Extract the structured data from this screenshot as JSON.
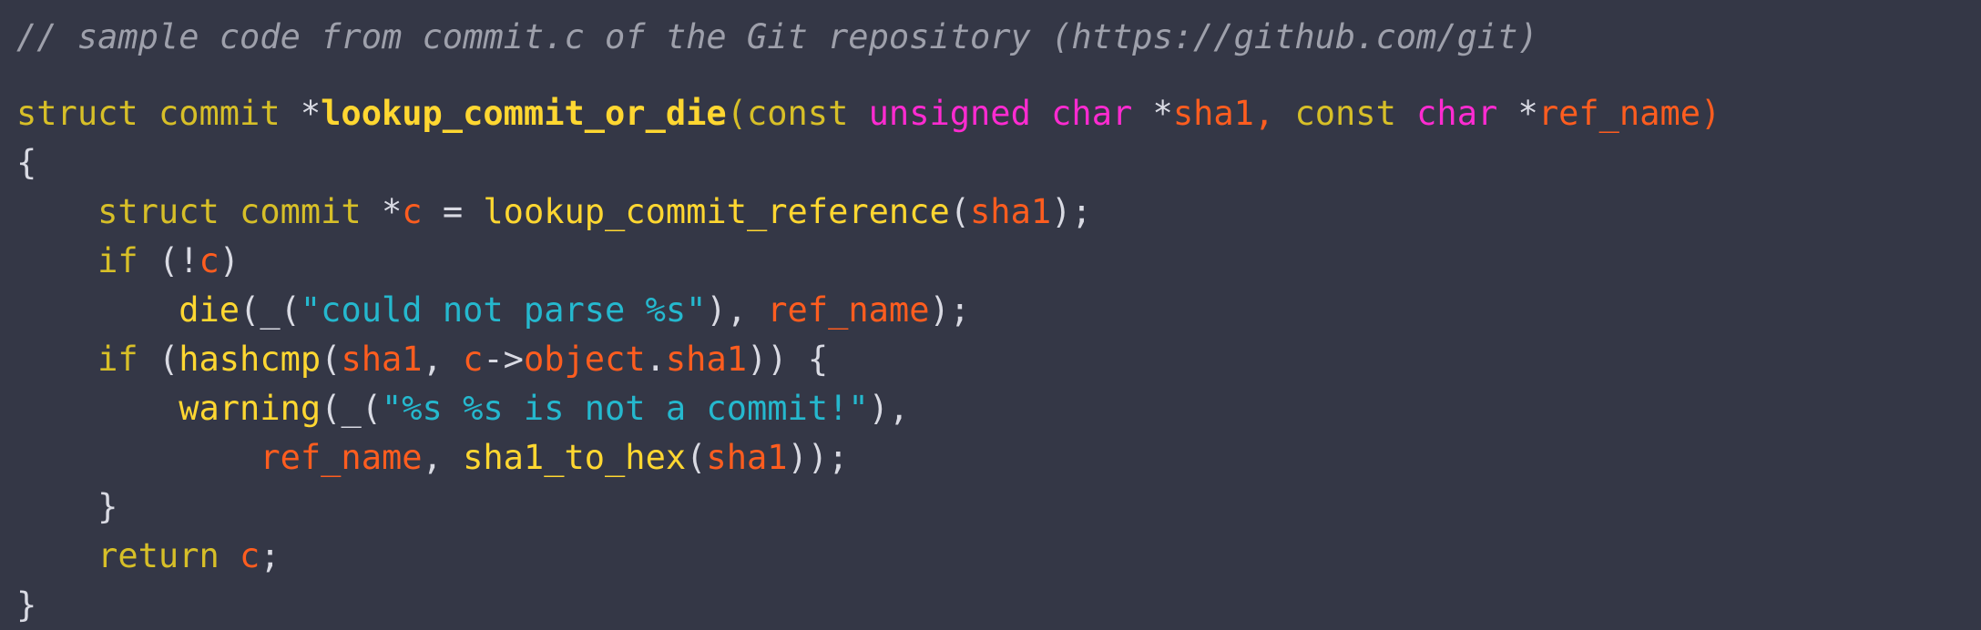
{
  "editor": {
    "background_color": "#343746",
    "font_size_px": 37,
    "language": "c"
  },
  "theme_colors": {
    "comment": "#9ea0ab",
    "keyword": "#d7bf28",
    "type": "#ff2bd1",
    "function": "#ffd731",
    "variable": "#ff5d1f",
    "string": "#25b8ce",
    "punctuation": "#d9dae3"
  },
  "comment_text": "// sample code from commit.c of the Git repository (https://github.com/git)",
  "source_file": "commit.c",
  "repository_url": "https://github.com/git",
  "code_lines": [
    {
      "id": "line-comment",
      "tokens": [
        {
          "t": "// sample code from commit.c of the Git repository (https://github.com/git)",
          "c": "tok-comment"
        }
      ]
    },
    {
      "id": "line-blank",
      "blank": true,
      "tokens": []
    },
    {
      "id": "line-signature",
      "tokens": [
        {
          "t": "struct",
          "c": "tok-keyword"
        },
        {
          "t": " ",
          "c": "tok-plain"
        },
        {
          "t": "commit",
          "c": "tok-keyword"
        },
        {
          "t": " ",
          "c": "tok-plain"
        },
        {
          "t": "*",
          "c": "tok-punct"
        },
        {
          "t": "lookup_commit_or_die",
          "c": "tok-func-def"
        },
        {
          "t": "(",
          "c": "tok-keyword"
        },
        {
          "t": "const",
          "c": "tok-keyword"
        },
        {
          "t": " ",
          "c": "tok-plain"
        },
        {
          "t": "unsigned",
          "c": "tok-type"
        },
        {
          "t": " ",
          "c": "tok-plain"
        },
        {
          "t": "char",
          "c": "tok-type"
        },
        {
          "t": " ",
          "c": "tok-plain"
        },
        {
          "t": "*",
          "c": "tok-punct"
        },
        {
          "t": "sha1",
          "c": "tok-var"
        },
        {
          "t": ",",
          "c": "tok-var"
        },
        {
          "t": " ",
          "c": "tok-plain"
        },
        {
          "t": "const",
          "c": "tok-keyword"
        },
        {
          "t": " ",
          "c": "tok-plain"
        },
        {
          "t": "char",
          "c": "tok-type"
        },
        {
          "t": " ",
          "c": "tok-plain"
        },
        {
          "t": "*",
          "c": "tok-punct"
        },
        {
          "t": "ref_name",
          "c": "tok-var"
        },
        {
          "t": ")",
          "c": "tok-var"
        }
      ]
    },
    {
      "id": "line-open-brace",
      "tokens": [
        {
          "t": "{",
          "c": "tok-punct"
        }
      ]
    },
    {
      "id": "line-decl-c",
      "tokens": [
        {
          "t": "    ",
          "c": "tok-plain"
        },
        {
          "t": "struct",
          "c": "tok-keyword"
        },
        {
          "t": " ",
          "c": "tok-plain"
        },
        {
          "t": "commit",
          "c": "tok-keyword"
        },
        {
          "t": " ",
          "c": "tok-plain"
        },
        {
          "t": "*",
          "c": "tok-punct"
        },
        {
          "t": "c",
          "c": "tok-var"
        },
        {
          "t": " ",
          "c": "tok-plain"
        },
        {
          "t": "=",
          "c": "tok-punct"
        },
        {
          "t": " ",
          "c": "tok-plain"
        },
        {
          "t": "lookup_commit_reference",
          "c": "tok-func"
        },
        {
          "t": "(",
          "c": "tok-punct"
        },
        {
          "t": "sha1",
          "c": "tok-var"
        },
        {
          "t": ");",
          "c": "tok-punct"
        }
      ]
    },
    {
      "id": "line-if-not-c",
      "tokens": [
        {
          "t": "    ",
          "c": "tok-plain"
        },
        {
          "t": "if",
          "c": "tok-keyword"
        },
        {
          "t": " ",
          "c": "tok-plain"
        },
        {
          "t": "(!",
          "c": "tok-punct"
        },
        {
          "t": "c",
          "c": "tok-var"
        },
        {
          "t": ")",
          "c": "tok-punct"
        }
      ]
    },
    {
      "id": "line-die",
      "tokens": [
        {
          "t": "        ",
          "c": "tok-plain"
        },
        {
          "t": "die",
          "c": "tok-func"
        },
        {
          "t": "(",
          "c": "tok-punct"
        },
        {
          "t": "_",
          "c": "tok-punct"
        },
        {
          "t": "(",
          "c": "tok-punct"
        },
        {
          "t": "\"could not parse %s\"",
          "c": "tok-string"
        },
        {
          "t": "),",
          "c": "tok-punct"
        },
        {
          "t": " ",
          "c": "tok-plain"
        },
        {
          "t": "ref_name",
          "c": "tok-var"
        },
        {
          "t": ");",
          "c": "tok-punct"
        }
      ]
    },
    {
      "id": "line-if-hashcmp",
      "tokens": [
        {
          "t": "    ",
          "c": "tok-plain"
        },
        {
          "t": "if",
          "c": "tok-keyword"
        },
        {
          "t": " ",
          "c": "tok-plain"
        },
        {
          "t": "(",
          "c": "tok-punct"
        },
        {
          "t": "hashcmp",
          "c": "tok-func"
        },
        {
          "t": "(",
          "c": "tok-punct"
        },
        {
          "t": "sha1",
          "c": "tok-var"
        },
        {
          "t": ",",
          "c": "tok-punct"
        },
        {
          "t": " ",
          "c": "tok-plain"
        },
        {
          "t": "c",
          "c": "tok-var"
        },
        {
          "t": "->",
          "c": "tok-punct"
        },
        {
          "t": "object",
          "c": "tok-var"
        },
        {
          "t": ".",
          "c": "tok-punct"
        },
        {
          "t": "sha1",
          "c": "tok-var"
        },
        {
          "t": ")) {",
          "c": "tok-punct"
        }
      ]
    },
    {
      "id": "line-warning",
      "tokens": [
        {
          "t": "        ",
          "c": "tok-plain"
        },
        {
          "t": "warning",
          "c": "tok-func"
        },
        {
          "t": "(",
          "c": "tok-punct"
        },
        {
          "t": "_",
          "c": "tok-punct"
        },
        {
          "t": "(",
          "c": "tok-punct"
        },
        {
          "t": "\"%s %s is not a commit!\"",
          "c": "tok-string"
        },
        {
          "t": "),",
          "c": "tok-punct"
        }
      ]
    },
    {
      "id": "line-warning-args",
      "tokens": [
        {
          "t": "            ",
          "c": "tok-plain"
        },
        {
          "t": "ref_name",
          "c": "tok-var"
        },
        {
          "t": ",",
          "c": "tok-punct"
        },
        {
          "t": " ",
          "c": "tok-plain"
        },
        {
          "t": "sha1_to_hex",
          "c": "tok-func"
        },
        {
          "t": "(",
          "c": "tok-punct"
        },
        {
          "t": "sha1",
          "c": "tok-var"
        },
        {
          "t": "));",
          "c": "tok-punct"
        }
      ]
    },
    {
      "id": "line-close-inner-brace",
      "tokens": [
        {
          "t": "    ",
          "c": "tok-plain"
        },
        {
          "t": "}",
          "c": "tok-punct"
        }
      ]
    },
    {
      "id": "line-return",
      "tokens": [
        {
          "t": "    ",
          "c": "tok-plain"
        },
        {
          "t": "return",
          "c": "tok-keyword"
        },
        {
          "t": " ",
          "c": "tok-plain"
        },
        {
          "t": "c",
          "c": "tok-var"
        },
        {
          "t": ";",
          "c": "tok-punct"
        }
      ]
    },
    {
      "id": "line-close-brace",
      "tokens": [
        {
          "t": "}",
          "c": "tok-punct"
        }
      ]
    }
  ]
}
